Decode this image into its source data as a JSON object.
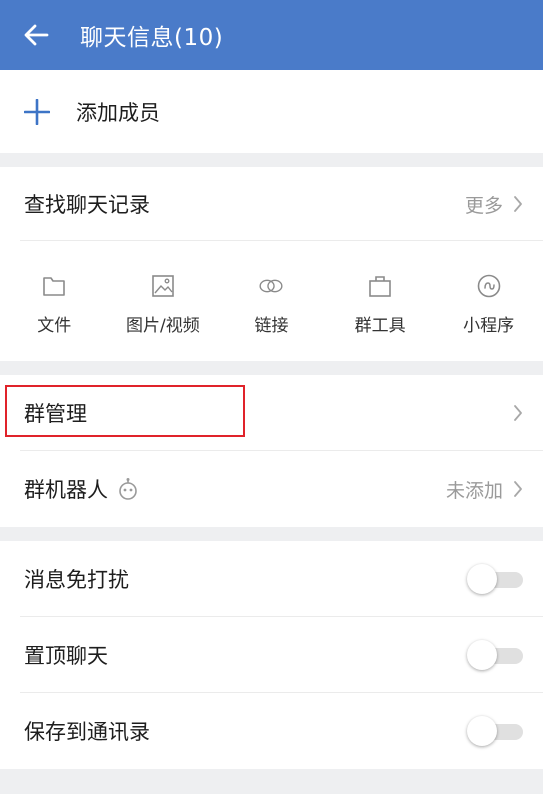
{
  "header": {
    "title": "聊天信息(10)",
    "back_icon": "arrow-left-icon"
  },
  "members": {
    "add_label": "添加成员",
    "add_icon": "plus-icon"
  },
  "search": {
    "label": "查找聊天记录",
    "more": "更多"
  },
  "tools": [
    {
      "label": "文件",
      "icon": "folder-icon"
    },
    {
      "label": "图片/视频",
      "icon": "image-icon"
    },
    {
      "label": "链接",
      "icon": "link-icon"
    },
    {
      "label": "群工具",
      "icon": "briefcase-icon"
    },
    {
      "label": "小程序",
      "icon": "miniprogram-icon"
    }
  ],
  "group": {
    "manage_label": "群管理",
    "robot_label": "群机器人",
    "robot_status": "未添加"
  },
  "settings": [
    {
      "label": "消息免打扰",
      "on": false
    },
    {
      "label": "置顶聊天",
      "on": false
    },
    {
      "label": "保存到通讯录",
      "on": false
    }
  ],
  "colors": {
    "header": "#4a7bc9",
    "accent": "#3d74c6",
    "highlight": "#e0232a"
  }
}
